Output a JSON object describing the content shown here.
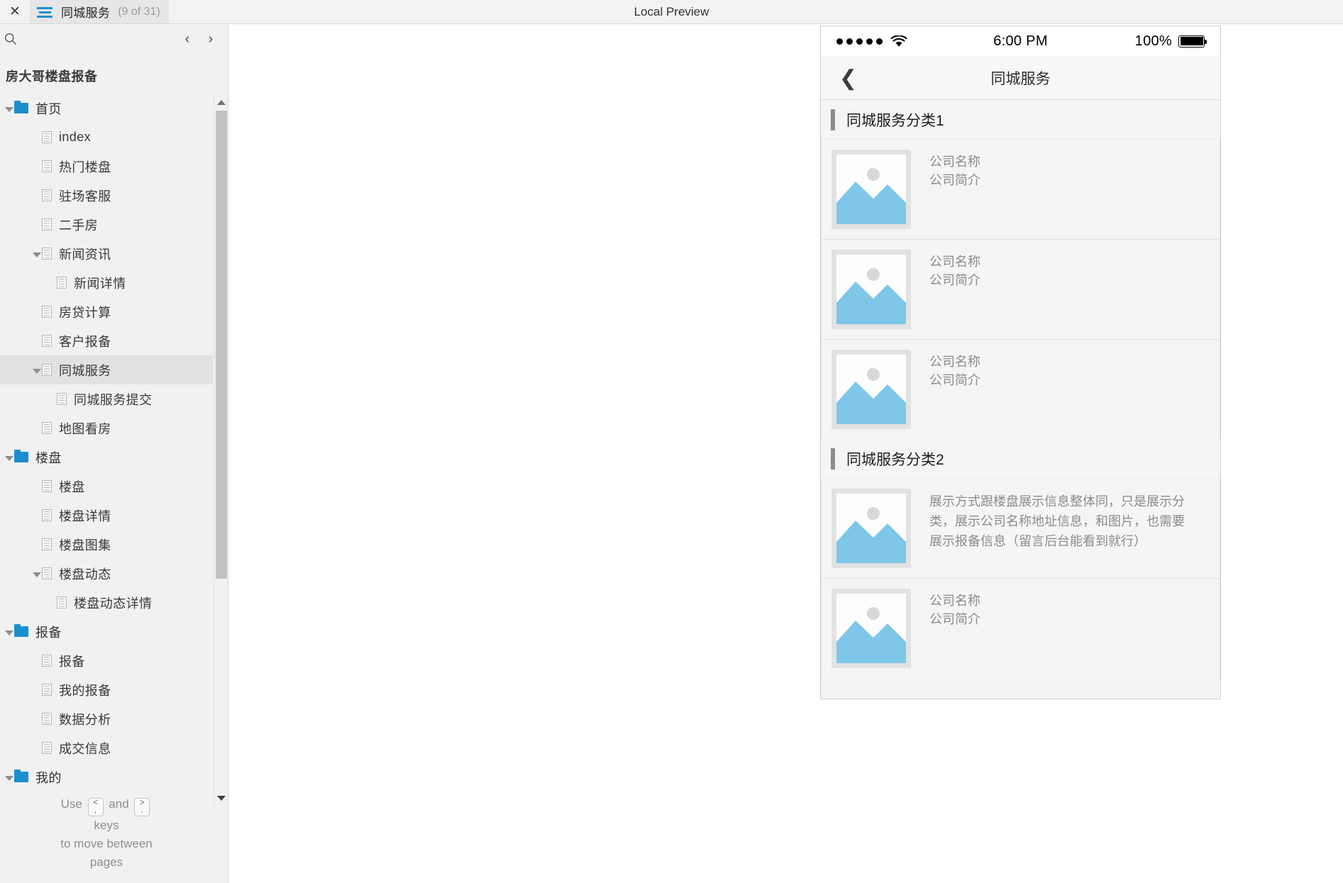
{
  "topbar": {
    "close_label": "✕",
    "tab_icon": "hamburger-icon",
    "tab_title": "同城服务",
    "tab_count": "(9 of 31)",
    "window_title": "Local Preview"
  },
  "sidebar": {
    "search_icon": "search-icon",
    "prev_label": "‹",
    "next_label": "›",
    "project_title": "房大哥楼盘报备",
    "tree": [
      {
        "label": "首页",
        "type": "folder",
        "depth": 0,
        "caret": true,
        "selected": false
      },
      {
        "label": "index",
        "type": "page",
        "depth": 1,
        "caret": false,
        "selected": false
      },
      {
        "label": "热门楼盘",
        "type": "page",
        "depth": 1,
        "caret": false,
        "selected": false
      },
      {
        "label": "驻场客服",
        "type": "page",
        "depth": 1,
        "caret": false,
        "selected": false
      },
      {
        "label": "二手房",
        "type": "page",
        "depth": 1,
        "caret": false,
        "selected": false
      },
      {
        "label": "新闻资讯",
        "type": "page",
        "depth": 1,
        "caret": true,
        "selected": false
      },
      {
        "label": "新闻详情",
        "type": "page",
        "depth": 2,
        "caret": false,
        "selected": false
      },
      {
        "label": "房贷计算",
        "type": "page",
        "depth": 1,
        "caret": false,
        "selected": false
      },
      {
        "label": "客户报备",
        "type": "page",
        "depth": 1,
        "caret": false,
        "selected": false
      },
      {
        "label": "同城服务",
        "type": "page",
        "depth": 1,
        "caret": true,
        "selected": true
      },
      {
        "label": "同城服务提交",
        "type": "page",
        "depth": 2,
        "caret": false,
        "selected": false
      },
      {
        "label": "地图看房",
        "type": "page",
        "depth": 1,
        "caret": false,
        "selected": false
      },
      {
        "label": "楼盘",
        "type": "folder",
        "depth": 0,
        "caret": true,
        "selected": false
      },
      {
        "label": "楼盘",
        "type": "page",
        "depth": 1,
        "caret": false,
        "selected": false
      },
      {
        "label": "楼盘详情",
        "type": "page",
        "depth": 1,
        "caret": false,
        "selected": false
      },
      {
        "label": "楼盘图集",
        "type": "page",
        "depth": 1,
        "caret": false,
        "selected": false
      },
      {
        "label": "楼盘动态",
        "type": "page",
        "depth": 1,
        "caret": true,
        "selected": false
      },
      {
        "label": "楼盘动态详情",
        "type": "page",
        "depth": 2,
        "caret": false,
        "selected": false
      },
      {
        "label": "报备",
        "type": "folder",
        "depth": 0,
        "caret": true,
        "selected": false
      },
      {
        "label": "报备",
        "type": "page",
        "depth": 1,
        "caret": false,
        "selected": false
      },
      {
        "label": "我的报备",
        "type": "page",
        "depth": 1,
        "caret": false,
        "selected": false
      },
      {
        "label": "数据分析",
        "type": "page",
        "depth": 1,
        "caret": false,
        "selected": false
      },
      {
        "label": "成交信息",
        "type": "page",
        "depth": 1,
        "caret": false,
        "selected": false
      },
      {
        "label": "我的",
        "type": "folder",
        "depth": 0,
        "caret": true,
        "selected": false
      }
    ],
    "hint": {
      "use": "Use",
      "key_prev_top": "<",
      "key_prev_bottom": ",",
      "and": "and",
      "key_next_top": ">",
      "key_next_bottom": ".",
      "keys": "keys",
      "line2": "to move between",
      "line3": "pages"
    }
  },
  "phone": {
    "status": {
      "signal": "●●●●●",
      "wifi_icon": "wifi-icon",
      "time": "6:00 PM",
      "battery_percent": "100%",
      "battery_icon": "battery-full-icon"
    },
    "navbar": {
      "back_icon": "chevron-left-icon",
      "title": "同城服务"
    },
    "sections": [
      {
        "title": "同城服务分类1",
        "rows": [
          {
            "image": "image-placeholder-icon",
            "lines": [
              "公司名称",
              "公司简介"
            ],
            "style": "short"
          },
          {
            "image": "image-placeholder-icon",
            "lines": [
              "公司名称",
              "公司简介"
            ],
            "style": "short"
          },
          {
            "image": "image-placeholder-icon",
            "lines": [
              "公司名称",
              "公司简介"
            ],
            "style": "short"
          }
        ]
      },
      {
        "title": "同城服务分类2",
        "rows": [
          {
            "image": "image-placeholder-icon",
            "lines": [
              "展示方式跟楼盘展示信息整体同，只是展示分类，展示公司名称地址信息，和图片，也需要展示报备信息（留言后台能看到就行）"
            ],
            "style": "desc"
          },
          {
            "image": "image-placeholder-icon",
            "lines": [
              "公司名称",
              "公司简介"
            ],
            "style": "short"
          }
        ]
      }
    ]
  },
  "colors": {
    "accent": "#1a8fd0",
    "thumb_blue": "#7ec7e8",
    "sidebar_bg": "#f1f1f1",
    "selected_row": "#e2e2e2"
  }
}
